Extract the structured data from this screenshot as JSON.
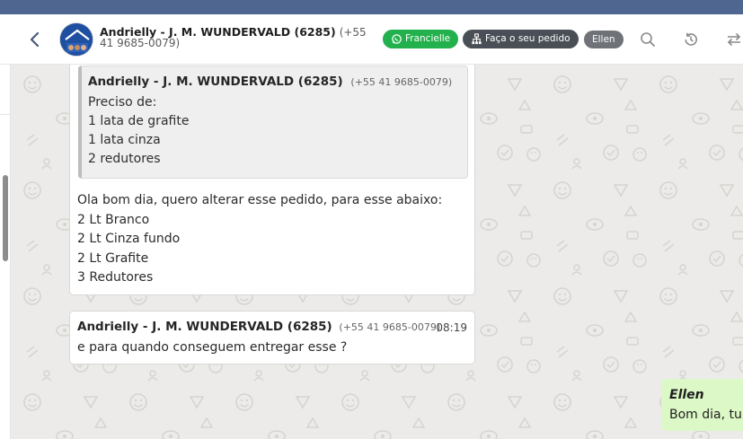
{
  "header": {
    "contact_name": "Andrielly - J. M. WUNDERVALD (6285)",
    "contact_phone": "(+55 41 9685-0079)",
    "tags": [
      {
        "label": "Francielle",
        "color": "#22b14c",
        "icon": "whatsapp-icon"
      },
      {
        "label": "Faça o seu pedido",
        "color": "#4a4f57",
        "icon": "org-chart-icon"
      },
      {
        "label": "Ellen",
        "color": "#6f7378"
      }
    ],
    "icons": [
      "back-arrow-icon",
      "search-icon",
      "history-icon",
      "transfer-icon"
    ]
  },
  "messages": [
    {
      "quote": {
        "author": "Andrielly - J. M. WUNDERVALD (6285)",
        "phone": "(+55 41 9685-0079)",
        "lines": [
          "Preciso de:",
          "1 lata de grafite",
          "1 lata cinza",
          "2 redutores"
        ]
      },
      "lines": [
        "Ola bom dia, quero alterar esse pedido, para esse abaixo:",
        "2 Lt Branco",
        "2 Lt Cinza fundo",
        "2 Lt Grafite",
        "3 Redutores"
      ]
    },
    {
      "author": "Andrielly - J. M. WUNDERVALD (6285)",
      "phone": "(+55 41 9685-0079)",
      "time": "08:19",
      "text": "e para quando conseguem entregar esse ?"
    },
    {
      "author": "Ellen",
      "text": "Bom dia, tu"
    }
  ]
}
